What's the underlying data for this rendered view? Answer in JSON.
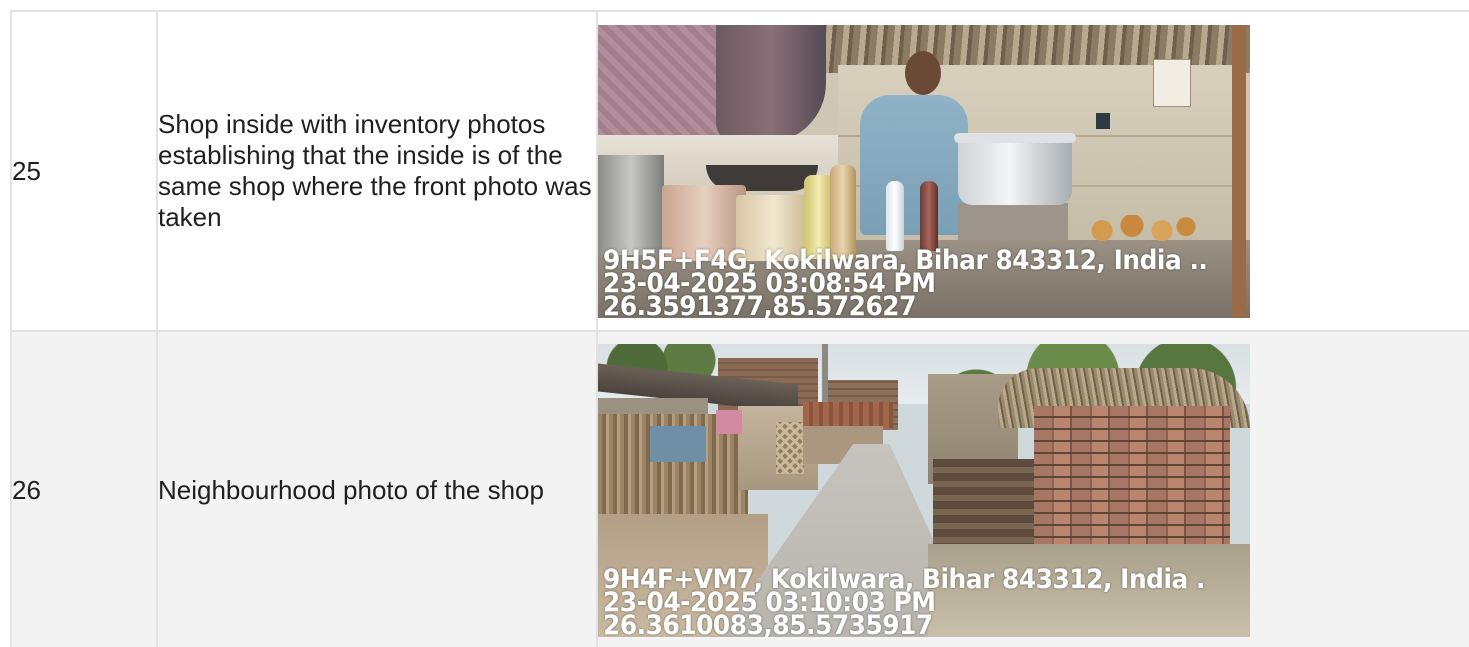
{
  "rows": [
    {
      "number": "25",
      "description": "Shop inside with inventory photos establishing that the inside is of the same shop where the front photo was taken",
      "photo": {
        "subject": "shop-interior",
        "overlay": {
          "address": "9H5F+F4G, Kokilwara, Bihar 843312, India ..",
          "datetime": "23-04-2025 03:08:54 PM",
          "coordinates": "26.3591377,85.572627"
        }
      }
    },
    {
      "number": "26",
      "description": "Neighbourhood photo of the shop",
      "photo": {
        "subject": "neighbourhood",
        "overlay": {
          "address": "9H4F+VM7, Kokilwara, Bihar 843312, India .",
          "datetime": "23-04-2025 03:10:03 PM",
          "coordinates": "26.3610083,85.5735917"
        }
      }
    }
  ],
  "colors": {
    "grid_border": "#e2e2e2",
    "alt_row_background": "#f3f3f3",
    "text": "#1f1f1f",
    "overlay_text": "#ffffff"
  }
}
